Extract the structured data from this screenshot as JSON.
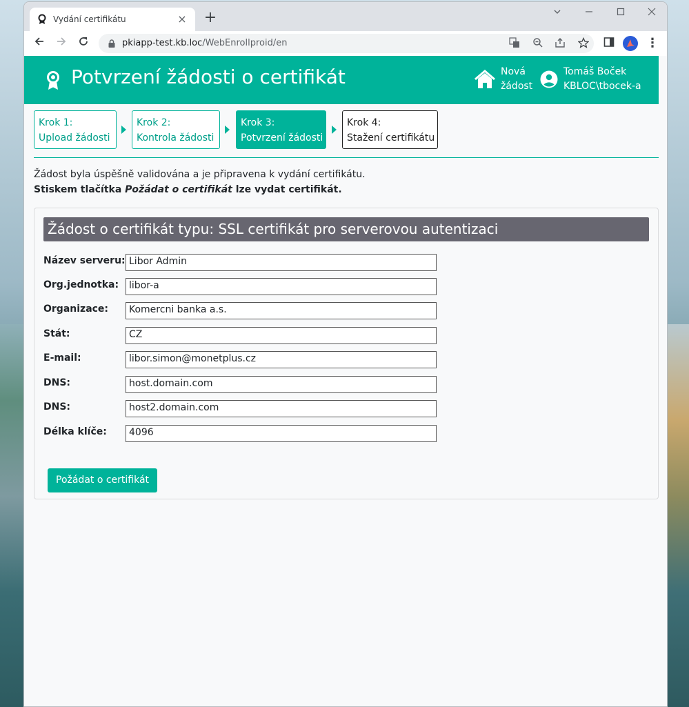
{
  "browser": {
    "tab_title": "Vydání certifikátu",
    "tab_close": "×",
    "new_tab": "+",
    "url_host": "pkiapp-test.kb.loc",
    "url_path": "/WebEnrollproid/en",
    "window_controls": [
      "chevron-down",
      "minimize",
      "maximize",
      "close"
    ]
  },
  "header": {
    "title": "Potvrzení žádosti o certifikát",
    "new_request_line1": "Nová",
    "new_request_line2": "žádost",
    "user_name": "Tomáš Boček",
    "user_account": "KBLOC\\tbocek-a"
  },
  "steps": [
    {
      "line1": "Krok 1:",
      "line2": "Upload žádosti",
      "state": "done"
    },
    {
      "line1": "Krok 2:",
      "line2": "Kontrola žádosti",
      "state": "done"
    },
    {
      "line1": "Krok 3:",
      "line2": "Potvrzení žádosti",
      "state": "active"
    },
    {
      "line1": "Krok 4:",
      "line2": "Stažení certifikátu",
      "state": "inactive"
    }
  ],
  "info": {
    "line1": "Žádost byla úspěšně validována a je připravena k vydání certifikátu.",
    "line2_prefix": "Stiskem tlačítka ",
    "line2_emphasis": "Požádat o certifikát",
    "line2_suffix": " lze vydat certifikát."
  },
  "card": {
    "title": "Žádost o certifikát typu: SSL certifikát pro serverovou autentizaci",
    "fields": [
      {
        "label": "Název serveru:",
        "value": "Libor Admin"
      },
      {
        "label": "Org.jednotka:",
        "value": "libor-a"
      },
      {
        "label": "Organizace:",
        "value": "Komercni banka a.s."
      },
      {
        "label": "Stát:",
        "value": "CZ"
      },
      {
        "label": "E-mail:",
        "value": "libor.simon@monetplus.cz"
      },
      {
        "label": "DNS:",
        "value": "host.domain.com"
      },
      {
        "label": "DNS:",
        "value": "host2.domain.com"
      },
      {
        "label": "Délka klíče:",
        "value": "4096"
      }
    ],
    "submit_label": "Požádat o certifikát"
  },
  "colors": {
    "brand": "#00b39a",
    "card_title_bg": "#676670"
  }
}
